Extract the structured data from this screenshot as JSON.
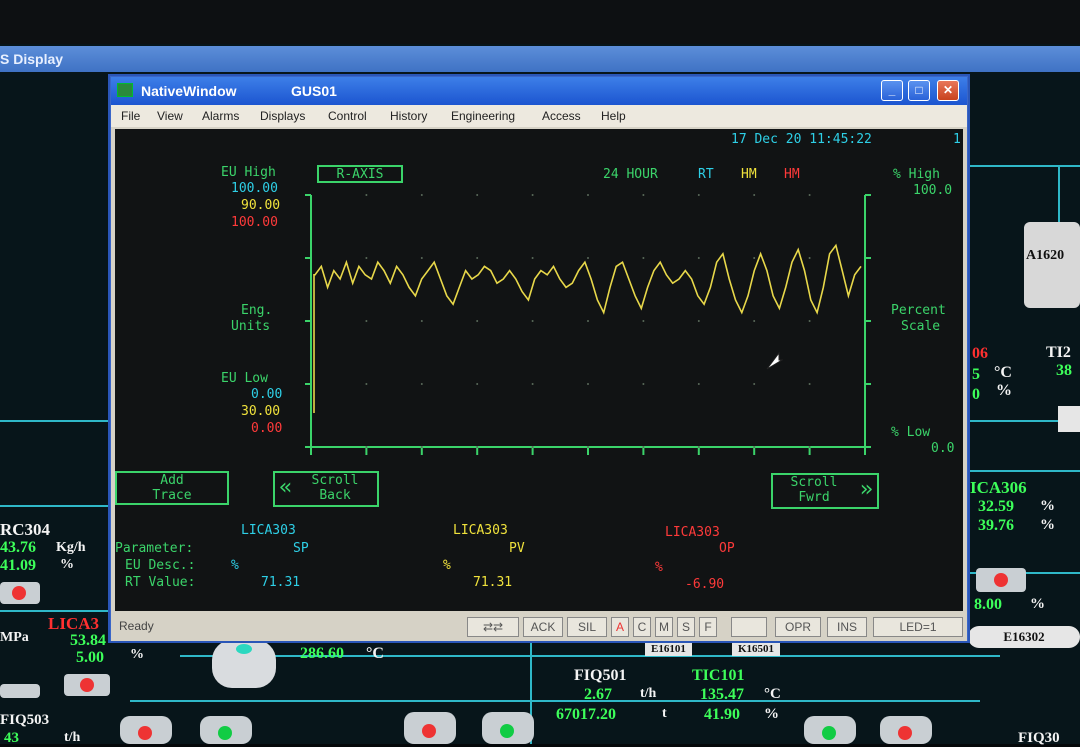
{
  "background": {
    "title": "S Display",
    "labels": {
      "rc304": "RC304",
      "rc304_v1": "43.76",
      "rc304_u1": "Kg/h",
      "rc304_v2": "41.09",
      "rc304_u2": "%",
      "lica3": "LICA3",
      "lica3_v1": "53.84",
      "lica3_v2": "5.00",
      "lica3_u": "%",
      "mpa": "MPa",
      "t286": "286.60",
      "t286_u": "°C",
      "fiq501": "FIQ501",
      "fiq501_v1": "2.67",
      "fiq501_u1": "t/h",
      "fiq501_v2": "67017.20",
      "fiq501_u2": "t",
      "tic101": "TIC101",
      "tic101_v1": "135.47",
      "tic101_u1": "°C",
      "tic101_v2": "41.90",
      "tic101_u2": "%",
      "fiq503": "FIQ503",
      "fiq503_v": "43",
      "fiq503_u": "t/h",
      "ica306": "ICA306",
      "ica306_v1": "32.59",
      "ica306_v2": "39.76",
      "ica306_u": "%",
      "v800": "8.00",
      "v800_u": "%",
      "e16302": "E16302",
      "e16101": "E16101",
      "k16501": "K16501",
      "a1620": "A1620",
      "ti2": "TI2",
      "ti2_v": "38",
      "s06": "06",
      "s5": "5",
      "s5_u": "°C",
      "s0": "0",
      "s0_u": "%",
      "fiq30": "FIQ30"
    }
  },
  "window": {
    "app_title": "NativeWindow",
    "doc_title": "GUS01",
    "menu": [
      "File",
      "View",
      "Alarms",
      "Displays",
      "Control",
      "History",
      "Engineering",
      "Access",
      "Help"
    ],
    "timestamp": "17 Dec 20 11:45:22",
    "timestamp_suffix": "1",
    "status": "Ready",
    "status_buttons": [
      "ACK",
      "SIL",
      "A",
      "C",
      "M",
      "S",
      "F",
      "",
      "OPR",
      "INS",
      "LED=1"
    ]
  },
  "trend": {
    "axis_button": "R-AXIS",
    "range_label": "24 HOUR",
    "rt_label": "RT",
    "hm1": "HM",
    "hm2": "HM",
    "eu_high_label": "EU High",
    "eu_high": [
      "100.00",
      "90.00",
      "100.00"
    ],
    "eng_units": [
      "Eng.",
      "Units"
    ],
    "eu_low_label": "EU Low",
    "eu_low": [
      "0.00",
      "30.00",
      "0.00"
    ],
    "pct_high_label": "% High",
    "pct_high_value": "100.0",
    "percent_scale": [
      "Percent",
      "Scale"
    ],
    "pct_low_label": "% Low",
    "pct_low_value": "0.0",
    "add_trace": [
      "Add",
      "Trace"
    ],
    "scroll_back": [
      "Scroll",
      "Back"
    ],
    "scroll_fwrd": [
      "Scroll",
      "Fwrd"
    ],
    "colors": {
      "grid": "#3bd46a",
      "trace": "#e8d84a",
      "cyan": "#2ecfe6",
      "yellow": "#f0e23c",
      "red": "#ff3a3a"
    }
  },
  "chart_data": {
    "type": "line",
    "title": "",
    "xlabel": "",
    "ylabel": "",
    "ylim": [
      30,
      90
    ],
    "grid": true,
    "series": [
      {
        "name": "LICA303 PV",
        "values": [
          71,
          73,
          68,
          72,
          70,
          74,
          69,
          73,
          71,
          70,
          74,
          72,
          69,
          73,
          71,
          68,
          66,
          70,
          72,
          74,
          70,
          66,
          64,
          68,
          72,
          70,
          71,
          73,
          72,
          69,
          70,
          72,
          70,
          67,
          65,
          70,
          72,
          71,
          73,
          70,
          68,
          69,
          72,
          74,
          70,
          65,
          62,
          68,
          73,
          74,
          70,
          66,
          63,
          68,
          72,
          74,
          71,
          69,
          70,
          72,
          70,
          66,
          64,
          68,
          74,
          76,
          70,
          65,
          62,
          66,
          72,
          76,
          72,
          66,
          63,
          68,
          74,
          77,
          72,
          65,
          62,
          68,
          76,
          78,
          72,
          66,
          71,
          73
        ]
      }
    ]
  },
  "params": {
    "parameter_label": "Parameter:",
    "eu_desc_label": "EU Desc.:",
    "rt_value_label": "RT Value:",
    "columns": [
      {
        "tag": "LICA303",
        "param": "SP",
        "eu": "%",
        "value": "71.31"
      },
      {
        "tag": "LICA303",
        "param": "PV",
        "eu": "%",
        "value": "71.31"
      },
      {
        "tag": "LICA303",
        "param": "OP",
        "eu": "%",
        "value": "-6.90"
      }
    ]
  }
}
